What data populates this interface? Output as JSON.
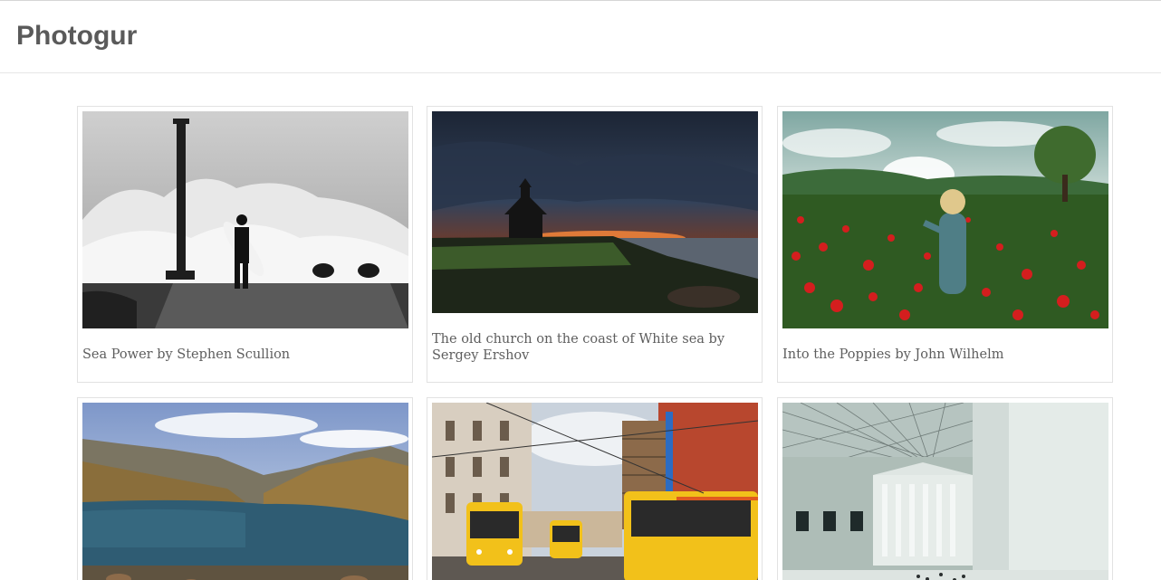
{
  "app": {
    "title": "Photogur"
  },
  "photos": [
    {
      "caption": "Sea Power by Stephen Scullion",
      "icon": "surfer-wave-photo"
    },
    {
      "caption": "The old church on the coast of White sea by Sergey Ershov",
      "icon": "church-sunset-photo"
    },
    {
      "caption": "Into the Poppies by John Wilhelm",
      "icon": "poppy-field-photo"
    },
    {
      "caption": "",
      "icon": "mountain-lake-photo"
    },
    {
      "caption": "",
      "icon": "city-trams-photo"
    },
    {
      "caption": "",
      "icon": "museum-courtyard-photo"
    }
  ],
  "colors": {
    "text": "#555555",
    "border": "#e2e2e2",
    "background": "#ffffff"
  }
}
